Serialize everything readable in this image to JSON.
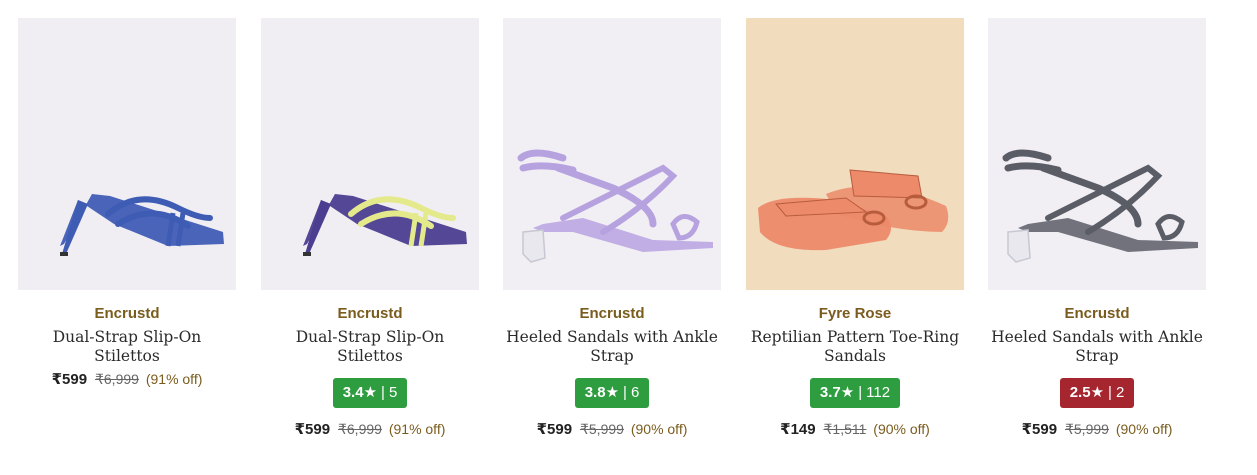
{
  "products": [
    {
      "brand": "Encrustd",
      "title": "Dual-Strap Slip-On Stilettos",
      "rating": null,
      "price": "₹599",
      "mrp": "₹6,999",
      "discount": "(91% off)",
      "image_bg": "#f0eef3",
      "shoe_color": "#3f5cb5",
      "strap_color": "#3f5cb5",
      "icon": "stiletto-image"
    },
    {
      "brand": "Encrustd",
      "title": "Dual-Strap Slip-On Stilettos",
      "rating": {
        "score": "3.4★",
        "sep": "|",
        "count": "5",
        "color": "#2e9d3f"
      },
      "price": "₹599",
      "mrp": "₹6,999",
      "discount": "(91% off)",
      "image_bg": "#f0eef3",
      "shoe_color": "#4b3d8f",
      "strap_color": "#e4ea8c",
      "icon": "stiletto-image"
    },
    {
      "brand": "Encrustd",
      "title": "Heeled Sandals with Ankle Strap",
      "rating": {
        "score": "3.8★",
        "sep": "|",
        "count": "6",
        "color": "#2e9d3f"
      },
      "price": "₹599",
      "mrp": "₹5,999",
      "discount": "(90% off)",
      "image_bg": "#f1eff4",
      "shoe_color": "#b7a2e0",
      "strap_color": "#b7a2e0",
      "icon": "block-heel-sandal-image"
    },
    {
      "brand": "Fyre Rose",
      "title": "Reptilian Pattern Toe-Ring Sandals",
      "rating": {
        "score": "3.7★",
        "sep": "|",
        "count": "112",
        "color": "#2e9d3f"
      },
      "price": "₹149",
      "mrp": "₹1,511",
      "discount": "(90% off)",
      "image_bg": "#f1dcbd",
      "shoe_color": "#ec8a6a",
      "strap_color": "#ec8a6a",
      "icon": "flat-sandal-image"
    },
    {
      "brand": "Encrustd",
      "title": "Heeled Sandals with Ankle Strap",
      "rating": {
        "score": "2.5★",
        "sep": "|",
        "count": "2",
        "color": "#a6262f"
      },
      "price": "₹599",
      "mrp": "₹5,999",
      "discount": "(90% off)",
      "image_bg": "#f1eff4",
      "shoe_color": "#5a5c66",
      "strap_color": "#5a5c66",
      "icon": "block-heel-sandal-image"
    }
  ]
}
